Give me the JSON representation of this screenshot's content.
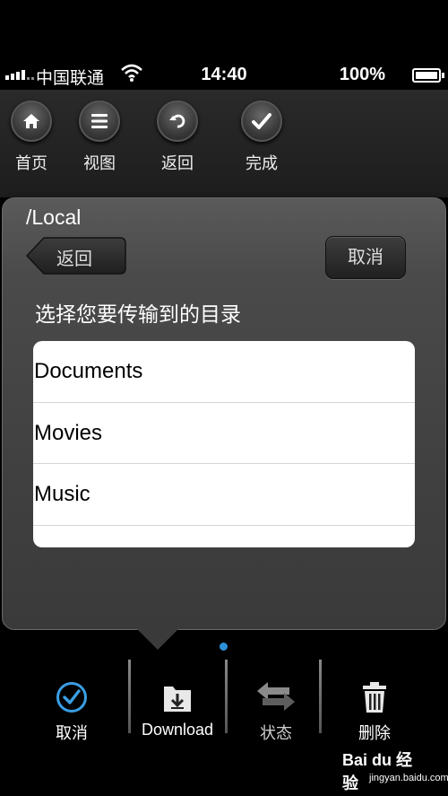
{
  "status": {
    "carrier": "中国联通",
    "time": "14:40",
    "battery": "100%"
  },
  "toolbar": {
    "items": [
      {
        "label": "首页",
        "icon": "home-icon"
      },
      {
        "label": "视图",
        "icon": "menu-icon"
      },
      {
        "label": "返回",
        "icon": "undo-icon"
      },
      {
        "label": "完成",
        "icon": "check-icon"
      }
    ]
  },
  "dialog": {
    "path": "/Local",
    "back_label": "返回",
    "cancel_label": "取消",
    "prompt": "选择您要传输到的目录",
    "folders": [
      "Documents",
      "Movies",
      "Music",
      ""
    ]
  },
  "tabbar": {
    "items": [
      {
        "label": "取消",
        "icon": "check-circle-icon"
      },
      {
        "label": "Download",
        "icon": "download-folder-icon"
      },
      {
        "label": "状态",
        "icon": "transfer-arrows-icon"
      },
      {
        "label": "删除",
        "icon": "trash-icon"
      }
    ]
  },
  "watermark": {
    "logo": "Bai du 经验",
    "url": "jingyan.baidu.com"
  },
  "colors": {
    "accent": "#2f8fd8",
    "panel": "#444444",
    "list_bg": "#ffffff"
  }
}
